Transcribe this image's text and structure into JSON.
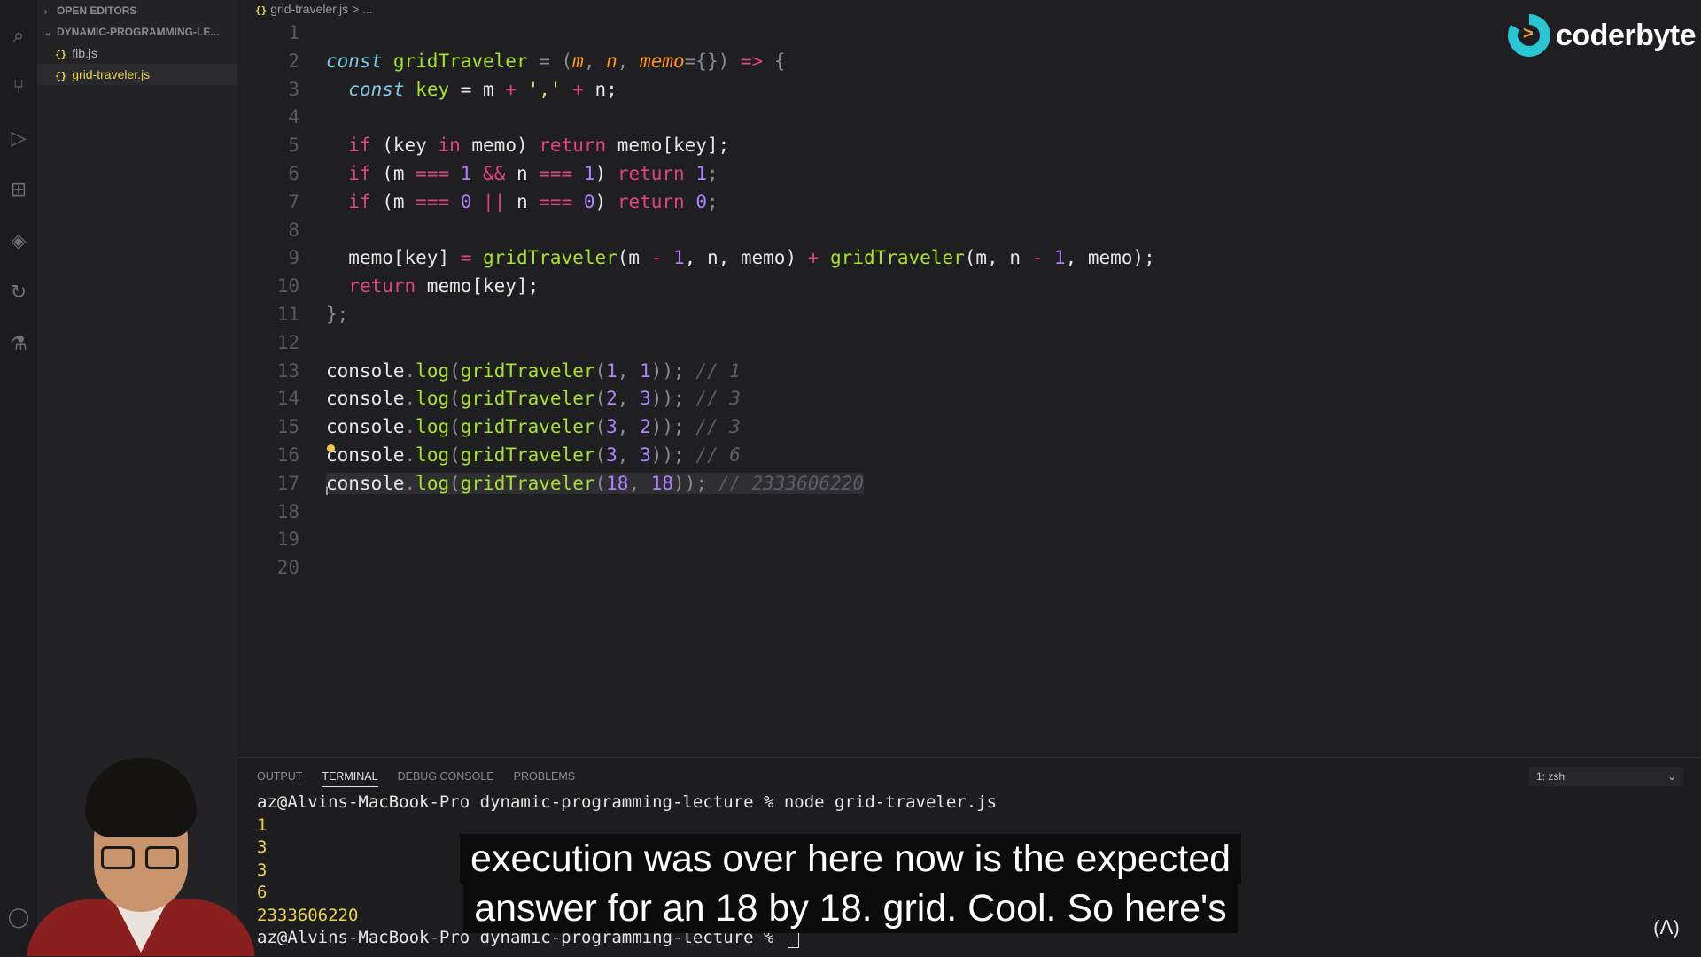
{
  "sidebar": {
    "open_editors": "OPEN EDITORS",
    "folder": "DYNAMIC-PROGRAMMING-LE...",
    "files": [
      {
        "icon": "{}",
        "name": "fib.js"
      },
      {
        "icon": "{}",
        "name": "grid-traveler.js"
      }
    ]
  },
  "breadcrumb": {
    "icon": "{}",
    "file": "grid-traveler.js",
    "sep": ">",
    "more": "..."
  },
  "line_numbers": [
    "1",
    "2",
    "3",
    "4",
    "5",
    "6",
    "7",
    "8",
    "9",
    "10",
    "11",
    "12",
    "13",
    "14",
    "15",
    "16",
    "17",
    "18",
    "19",
    "20"
  ],
  "code": {
    "l2": {
      "const": "const",
      "name": "gridTraveler",
      "eq": " = (",
      "m": "m",
      "c1": ", ",
      "n": "n",
      "c2": ", ",
      "memo": "memo",
      "def": "={}) ",
      "arrow": "=>",
      "brace": " {"
    },
    "l3": {
      "const": "const",
      "key": "key",
      "rest1": " = m ",
      "plus1": "+",
      "str": " ',' ",
      "plus2": "+",
      "rest2": " n;"
    },
    "l5": {
      "if": "if",
      "p1": " (key ",
      "in": "in",
      "p2": " memo) ",
      "ret": "return",
      "p3": " memo[key];"
    },
    "l6": {
      "if": "if",
      "p1": " (m ",
      "eq1": "===",
      "one1": " 1 ",
      "and": "&&",
      "p2": " n ",
      "eq2": "===",
      "one2": " 1",
      "p3": ") ",
      "ret": "return",
      "one3": " 1",
      "semi": ";"
    },
    "l7": {
      "if": "if",
      "p1": " (m ",
      "eq1": "===",
      "z1": " 0 ",
      "or": "||",
      "p2": " n ",
      "eq2": "===",
      "z2": " 0",
      "p3": ") ",
      "ret": "return",
      "z3": " 0",
      "semi": ";"
    },
    "l9": {
      "a": "memo[key] ",
      "eq": "=",
      "fn1": " gridTraveler",
      "b": "(m ",
      "m1": "-",
      "one1": " 1",
      "c": ", n, memo) ",
      "plus": "+",
      "fn2": " gridTraveler",
      "d": "(m, n ",
      "m2": "-",
      "one2": " 1",
      "e": ", memo);"
    },
    "l10": {
      "ret": "return",
      "rest": " memo[key];"
    },
    "l11": "};",
    "logs": [
      {
        "obj": "console",
        "dot": ".",
        "log": "log",
        "p": "(",
        "fn": "gridTraveler",
        "args1": "(",
        "a": "1",
        "comma": ", ",
        "b": "1",
        "close": ")); ",
        "cmt": "// 1"
      },
      {
        "obj": "console",
        "dot": ".",
        "log": "log",
        "p": "(",
        "fn": "gridTraveler",
        "args1": "(",
        "a": "2",
        "comma": ", ",
        "b": "3",
        "close": ")); ",
        "cmt": "// 3"
      },
      {
        "obj": "console",
        "dot": ".",
        "log": "log",
        "p": "(",
        "fn": "gridTraveler",
        "args1": "(",
        "a": "3",
        "comma": ", ",
        "b": "2",
        "close": ")); ",
        "cmt": "// 3"
      },
      {
        "obj": "console",
        "dot": ".",
        "log": "log",
        "p": "(",
        "fn": "gridTraveler",
        "args1": "(",
        "a": "3",
        "comma": ", ",
        "b": "3",
        "close": ")); ",
        "cmt": "// 6"
      },
      {
        "obj": "console",
        "dot": ".",
        "log": "log",
        "p": "(",
        "fn": "gridTraveler",
        "args1": "(",
        "a": "18",
        "comma": ", ",
        "b": "18",
        "close": ")); ",
        "cmt": "// 2333606220"
      }
    ]
  },
  "logo": {
    "text": "coderbyte",
    "mark": ">"
  },
  "panel": {
    "tabs": [
      "OUTPUT",
      "TERMINAL",
      "DEBUG CONSOLE",
      "PROBLEMS"
    ],
    "terminal_select": "1: zsh",
    "terminal_lines": [
      "az@Alvins-MacBook-Pro dynamic-programming-lecture % node grid-traveler.js",
      "1",
      "3",
      "3",
      "6",
      "2333606220",
      "az@Alvins-MacBook-Pro dynamic-programming-lecture % "
    ]
  },
  "subtitles": [
    "execution was over here now is the expected",
    "answer for an 18 by 18. grid. Cool. So here's"
  ],
  "colors": {
    "accent": "#2ac6d3",
    "logo_orange": "#f29f3d",
    "terminal_output": "#e8d44d"
  }
}
